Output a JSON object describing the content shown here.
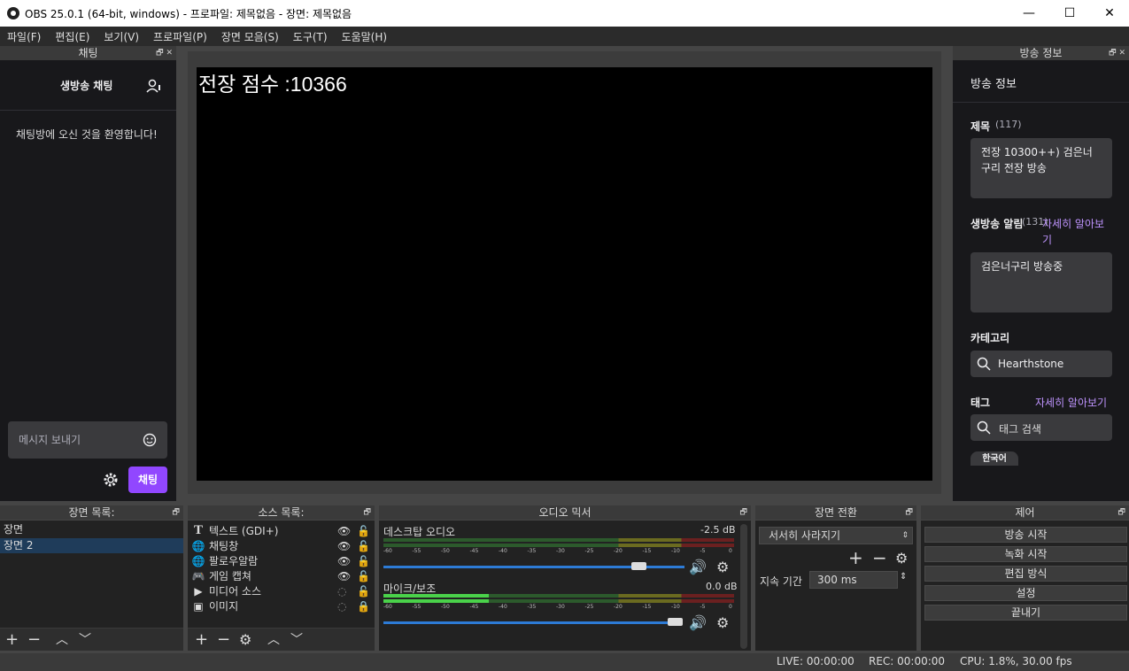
{
  "window": {
    "title": "OBS 25.0.1 (64-bit, windows) - 프로파일: 제목없음 - 장면: 제목없음",
    "minimize": "—",
    "maximize": "☐",
    "close": "✕"
  },
  "menu": [
    "파일(F)",
    "편집(E)",
    "보기(V)",
    "프로파일(P)",
    "장면 모음(S)",
    "도구(T)",
    "도움말(H)"
  ],
  "chat": {
    "dock_title": "채팅",
    "header": "생방송 채팅",
    "welcome": "채팅방에 오신 것을 환영합니다!",
    "input_placeholder": "메시지 보내기",
    "send_label": "채팅"
  },
  "preview": {
    "overlay_text": "전장 점수 :10366"
  },
  "stream_info": {
    "dock_title": "방송 정보",
    "heading": "방송 정보",
    "title_label": "제목",
    "title_count": "(117)",
    "title_value": "전장 10300++) 검은너구리 전장 방송",
    "notice_label": "생방송 알림",
    "notice_count": "(131)",
    "notice_link": "자세히 알아보기",
    "notice_value": "검은너구리 방송중",
    "category_label": "카테고리",
    "category_value": "Hearthstone",
    "tags_label": "태그",
    "tags_link": "자세히 알아보기",
    "tags_placeholder": "태그 검색",
    "tag_chip": "한국어"
  },
  "scenes": {
    "title": "장면 목록:",
    "items": [
      "장면",
      "장면 2"
    ],
    "selected": 1
  },
  "sources": {
    "title": "소스 목록:",
    "items": [
      {
        "icon": "text-icon",
        "name": "텍스트 (GDI+)",
        "visible": true,
        "locked": false
      },
      {
        "icon": "globe-icon",
        "name": "채팅창",
        "visible": true,
        "locked": false
      },
      {
        "icon": "globe-icon",
        "name": "팔로우알람",
        "visible": true,
        "locked": false
      },
      {
        "icon": "gamepad-icon",
        "name": "게임 캡쳐",
        "visible": true,
        "locked": false
      },
      {
        "icon": "play-icon",
        "name": "미디어 소스",
        "visible": false,
        "locked": false
      },
      {
        "icon": "image-icon",
        "name": "이미지",
        "visible": false,
        "locked": true
      }
    ]
  },
  "mixer": {
    "title": "오디오 믹서",
    "ticks": [
      "-60",
      "-55",
      "-50",
      "-45",
      "-40",
      "-35",
      "-30",
      "-25",
      "-20",
      "-15",
      "-10",
      "-5",
      "0"
    ],
    "channels": [
      {
        "name": "데스크탑 오디오",
        "db": "-2.5 dB",
        "level": 0.0,
        "volume": 0.85
      },
      {
        "name": "마이크/보조",
        "db": "0.0 dB",
        "level": 0.3,
        "volume": 1.0
      }
    ]
  },
  "transitions": {
    "title": "장면 전환",
    "selected": "서서히 사라지기",
    "duration_label": "지속 기간",
    "duration_value": "300 ms"
  },
  "controls": {
    "title": "제어",
    "buttons": [
      "방송 시작",
      "녹화 시작",
      "편집 방식",
      "설정",
      "끝내기"
    ]
  },
  "status": {
    "live": "LIVE: 00:00:00",
    "rec": "REC: 00:00:00",
    "cpu": "CPU: 1.8%, 30.00 fps"
  }
}
